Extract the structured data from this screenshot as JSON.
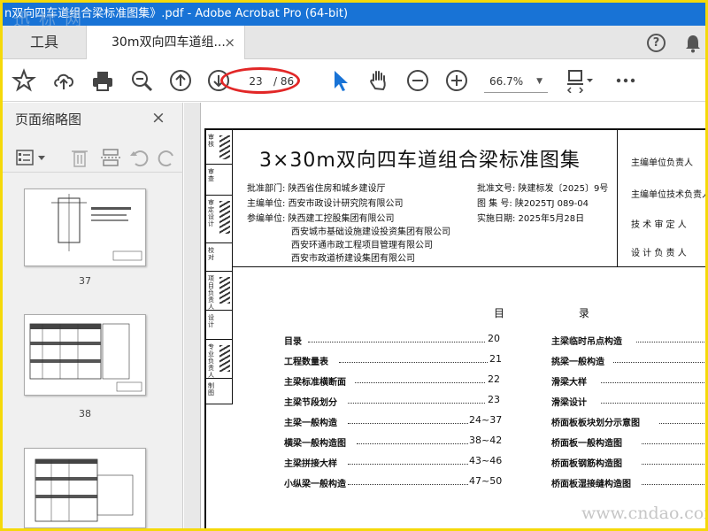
{
  "window": {
    "title": "n双向四车道组合梁标准图集》.pdf - Adobe Acrobat Pro (64-bit)",
    "watermark": "迅 标 网"
  },
  "tabs": {
    "tools_label": "工具",
    "doc_tab_label": "30m双向四车道组...",
    "close_glyph": "×",
    "help_glyph": "?"
  },
  "toolbar": {
    "page_current": "23",
    "page_total": "/ 86",
    "zoom": "66.7%",
    "accent": "#1873d6",
    "highlight": "#e22727"
  },
  "left_panel": {
    "title": "页面缩略图",
    "close_glyph": "×",
    "thumbnails": [
      {
        "label": "37"
      },
      {
        "label": "38"
      },
      {
        "label": ""
      }
    ]
  },
  "document": {
    "side_labels": [
      "审核",
      "审查",
      "审定设计",
      "校对",
      "项目负责人",
      "设计",
      "专业负责人",
      "制图"
    ],
    "title": "3×30m双向四车道组合梁标准图集",
    "approval_dept": "批准部门: 陕西省住房和城乡建设厅",
    "editor_unit": "主编单位:  西安市政设计研究院有限公司",
    "co_editor_1": "参编单位:  陕西建工控股集团有限公司",
    "co_editor_2": "西安城市基础设施建设投资集团有限公司",
    "co_editor_3": "西安环通市政工程项目管理有限公司",
    "co_editor_4": "西安市政道桥建设集团有限公司",
    "approval_no": "批准文号: 陕建标发〔2025〕9号",
    "atlas_no": "图  集  号: 陕2025TJ  089-04",
    "impl_date": "实施日期:  2025年5月28日",
    "right_labels": [
      "主编单位负责人",
      "主编单位技术负责人",
      "技 术 审 定 人",
      "设 计 负 责 人"
    ],
    "toc_title": "目  录",
    "toc_left": [
      {
        "name": "目录",
        "page": "20"
      },
      {
        "name": "工程数量表",
        "page": "21"
      },
      {
        "name": "主梁标准横断面",
        "page": "22"
      },
      {
        "name": "主梁节段划分",
        "page": "23"
      },
      {
        "name": "主梁一般构造",
        "page": "24~37"
      },
      {
        "name": "横梁一般构造图",
        "page": "38~42"
      },
      {
        "name": "主梁拼接大样",
        "page": "43~46"
      },
      {
        "name": "小纵梁一般构造",
        "page": "47~50"
      }
    ],
    "toc_right": [
      {
        "name": "主梁临时吊点构造"
      },
      {
        "name": "挑梁一般构造"
      },
      {
        "name": "滑梁大样"
      },
      {
        "name": "滑梁设计"
      },
      {
        "name": "桥面板板块划分示意图"
      },
      {
        "name": "桥面板一般构造图"
      },
      {
        "name": "桥面板钢筋构造图"
      },
      {
        "name": "桥面板湿接缝构造图"
      }
    ]
  },
  "footer_watermark": "www.cndao.com"
}
